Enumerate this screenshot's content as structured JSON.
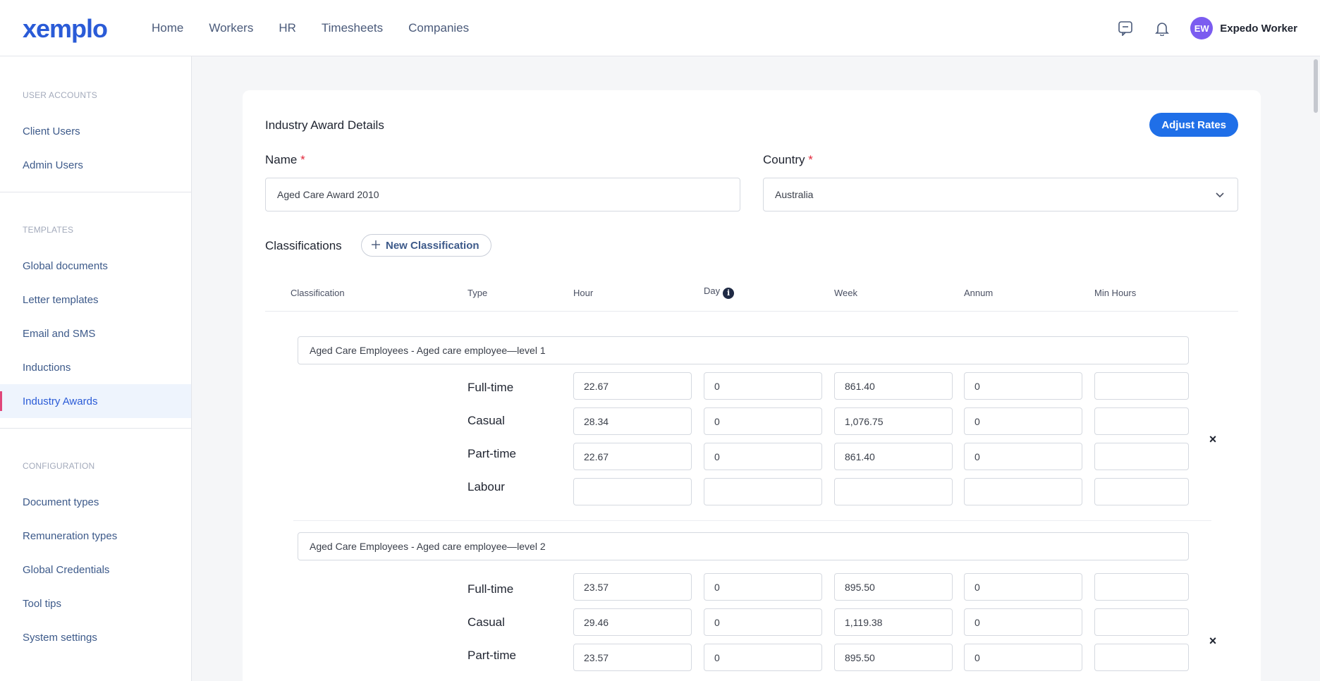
{
  "header": {
    "logo": "xemplo",
    "nav": [
      "Home",
      "Workers",
      "HR",
      "Timesheets",
      "Companies"
    ],
    "user_initials": "EW",
    "user_name": "Expedo Worker"
  },
  "sidebar": {
    "sections": [
      {
        "heading": "USER ACCOUNTS",
        "items": [
          "Client Users",
          "Admin Users"
        ]
      },
      {
        "heading": "TEMPLATES",
        "items": [
          "Global documents",
          "Letter templates",
          "Email and SMS",
          "Inductions",
          "Industry Awards"
        ]
      },
      {
        "heading": "CONFIGURATION",
        "items": [
          "Document types",
          "Remuneration types",
          "Global Credentials",
          "Tool tips",
          "System settings"
        ]
      }
    ],
    "active_item": "Industry Awards"
  },
  "form": {
    "title": "Industry Award Details",
    "adjust_label": "Adjust Rates",
    "name_label": "Name",
    "name_value": "Aged Care Award 2010",
    "country_label": "Country",
    "country_value": "Australia",
    "required_mark": "*"
  },
  "classifications": {
    "label": "Classifications",
    "new_button": "New Classification",
    "columns": [
      "Classification",
      "Type",
      "Hour",
      "Day",
      "Week",
      "Annum",
      "Min Hours"
    ],
    "info_glyph": "i",
    "remove_glyph": "×",
    "groups": [
      {
        "name": "Aged Care Employees - Aged care employee—level 1",
        "rows": [
          {
            "type": "Full-time",
            "values": [
              "22.67",
              "0",
              "861.40",
              "0",
              ""
            ]
          },
          {
            "type": "Casual",
            "values": [
              "28.34",
              "0",
              "1,076.75",
              "0",
              ""
            ]
          },
          {
            "type": "Part-time",
            "values": [
              "22.67",
              "0",
              "861.40",
              "0",
              ""
            ]
          },
          {
            "type": "Labour",
            "values": [
              "",
              "",
              "",
              "",
              ""
            ]
          }
        ]
      },
      {
        "name": "Aged Care Employees - Aged care employee—level 2",
        "rows": [
          {
            "type": "Full-time",
            "values": [
              "23.57",
              "0",
              "895.50",
              "0",
              ""
            ]
          },
          {
            "type": "Casual",
            "values": [
              "29.46",
              "0",
              "1,119.38",
              "0",
              ""
            ]
          },
          {
            "type": "Part-time",
            "values": [
              "23.57",
              "0",
              "895.50",
              "0",
              ""
            ]
          }
        ]
      }
    ]
  },
  "colors": {
    "accent": "#1f6fe8",
    "brand": "#2a5bd7",
    "active_indicator": "#e0467a",
    "avatar": "#7b5cf0"
  }
}
